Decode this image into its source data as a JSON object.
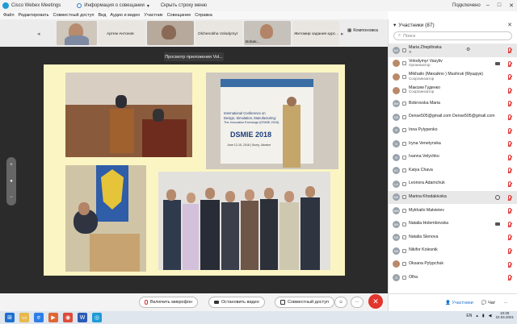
{
  "titlebar": {
    "app_title": "Cisco Webex Meetings",
    "info": "Информация о совещании",
    "hide_menu": "Скрыть строку меню",
    "connected": "Подключено"
  },
  "menu": [
    "Файл",
    "Редактировать",
    "Совместный доступ",
    "Вид",
    "Аудио и видео",
    "Участник",
    "Совещание",
    "Справка"
  ],
  "thumbnails": [
    {
      "name": "",
      "color": "#c7c1b8"
    },
    {
      "name": "Артем Антонов",
      "color": "#d6d0c4"
    },
    {
      "name": "Olchenokha Volodymyr",
      "color": "#bfb4a8"
    },
    {
      "name": "Bobak...",
      "color": "#c9c2b4"
    },
    {
      "name": "Житомир задания курс...",
      "color": "#c8c0b6"
    }
  ],
  "layout_button": "Компоновка",
  "share_banner": "Просмотр приложения Vol...",
  "conference_poster": {
    "line1": "International Conference on",
    "line2": "Design, Simulation, Manufacturing:",
    "line3": "The Innovation Exchange (DSMIE-2018)",
    "acronym": "DSMIE 2018",
    "dates": "June 12-15, 2018 | Sumy, Ukraine"
  },
  "controls": {
    "mic": "Включить микрофон",
    "video": "Остановить видео",
    "share": "Совместный доступ",
    "more": "···",
    "end": "✕"
  },
  "panel": {
    "title": "Участники (87)",
    "search_placeholder": "Поиск",
    "participants": [
      {
        "initials": "MZ",
        "name": "Maria Zhepilinska",
        "role": "Я",
        "highlight": true,
        "photo": false,
        "speaker": false,
        "camera": false
      },
      {
        "initials": "VV",
        "name": "Volodymyr Vasyliv",
        "role": "Организатор",
        "highlight": false,
        "photo": true,
        "speaker": false,
        "camera": true
      },
      {
        "initials": "MM",
        "name": "Mikhailo  (Михайло ) Mushruk (Мушрук)",
        "role": "Соорганизатор",
        "highlight": false,
        "photo": true,
        "speaker": false,
        "camera": false
      },
      {
        "initials": "МГ",
        "name": "Максим Гуденко",
        "role": "Соорганизатор",
        "highlight": false,
        "photo": true,
        "speaker": false,
        "camera": false
      },
      {
        "initials": "BM",
        "name": "Bobrovska Maria",
        "role": "",
        "highlight": false,
        "photo": false,
        "speaker": false,
        "camera": false
      },
      {
        "initials": "DE",
        "name": "Dense505@gmail.com Dense505@gmail.com",
        "role": "",
        "highlight": false,
        "photo": false,
        "speaker": false,
        "camera": false
      },
      {
        "initials": "IP",
        "name": "Inna Pylypenko",
        "role": "",
        "highlight": false,
        "photo": false,
        "speaker": false,
        "camera": false
      },
      {
        "initials": "IV",
        "name": "Iryna Venetynska",
        "role": "",
        "highlight": false,
        "photo": false,
        "speaker": false,
        "camera": false
      },
      {
        "initials": "IV",
        "name": "Ivanna Velychko",
        "role": "",
        "highlight": false,
        "photo": false,
        "speaker": false,
        "camera": false
      },
      {
        "initials": "KC",
        "name": "Katya Chava",
        "role": "",
        "highlight": false,
        "photo": false,
        "speaker": false,
        "camera": false
      },
      {
        "initials": "LA",
        "name": "Leonora Adamchuk",
        "role": "",
        "highlight": false,
        "photo": false,
        "speaker": false,
        "camera": false
      },
      {
        "initials": "MK",
        "name": "Marina Khodakivska",
        "role": "",
        "highlight": true,
        "photo": false,
        "speaker": true,
        "camera": false
      },
      {
        "initials": "MM",
        "name": "Mykhailo Matvieiev",
        "role": "",
        "highlight": false,
        "photo": false,
        "speaker": false,
        "camera": false
      },
      {
        "initials": "NH",
        "name": "Natalia Holembovska",
        "role": "",
        "highlight": false,
        "photo": false,
        "speaker": false,
        "camera": true
      },
      {
        "initials": "NS",
        "name": "Natalia Slenova",
        "role": "",
        "highlight": false,
        "photo": false,
        "speaker": false,
        "camera": false
      },
      {
        "initials": "NK",
        "name": "Nikifor Kolesnik",
        "role": "",
        "highlight": false,
        "photo": false,
        "speaker": false,
        "camera": false
      },
      {
        "initials": "OP",
        "name": "Oksana Pylypchuk",
        "role": "",
        "highlight": false,
        "photo": true,
        "speaker": false,
        "camera": false
      },
      {
        "initials": "O",
        "name": "Olha",
        "role": "",
        "highlight": false,
        "photo": false,
        "speaker": false,
        "camera": false
      }
    ],
    "footer_participants": "Участники",
    "footer_chat": "Чат"
  },
  "taskbar": {
    "lang": "EN",
    "time": "10:25",
    "date": "22.04.2021"
  },
  "colors": {
    "accent": "#1e9bd7",
    "end_red": "#e2352c",
    "slide_bg": "#fbf5c3",
    "share_bg": "#2b2b2b"
  }
}
